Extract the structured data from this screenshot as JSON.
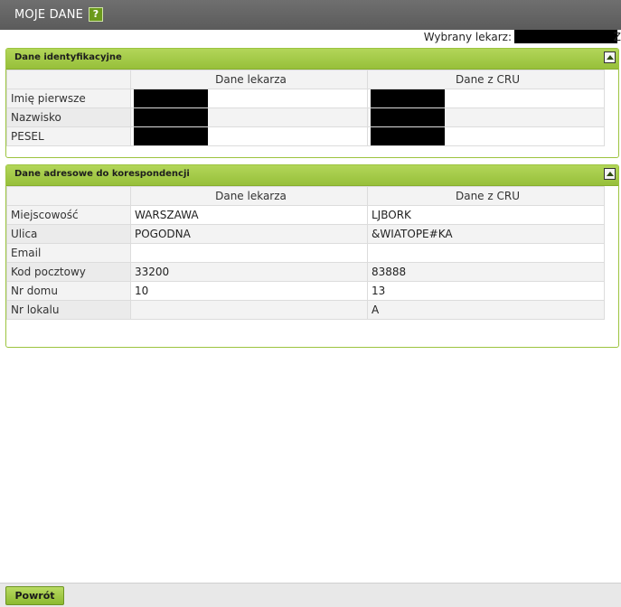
{
  "header": {
    "title": "MOJE DANE",
    "help_icon": "question-icon",
    "help_glyph": "?"
  },
  "doctor": {
    "label": "Wybrany lekarz:",
    "tail": "Z"
  },
  "identification": {
    "title": "Dane identyfikacyjne",
    "columns": [
      "Dane lekarza",
      "Dane z CRU"
    ],
    "rows": [
      {
        "label": "Imię pierwsze"
      },
      {
        "label": "Nazwisko"
      },
      {
        "label": "PESEL"
      }
    ]
  },
  "address": {
    "title": "Dane adresowe do korespondencji",
    "columns": [
      "Dane lekarza",
      "Dane z CRU"
    ],
    "rows": [
      {
        "label": "Miejscowość",
        "doctor": "WARSZAWA",
        "cru": "LJBORK"
      },
      {
        "label": "Ulica",
        "doctor": "POGODNA",
        "cru": "&WIATOPE#KA"
      },
      {
        "label": "Email",
        "doctor": "",
        "cru": ""
      },
      {
        "label": "Kod pocztowy",
        "doctor": "33200",
        "cru": "83888"
      },
      {
        "label": "Nr domu",
        "doctor": "10",
        "cru": "13"
      },
      {
        "label": "Nr lokalu",
        "doctor": "",
        "cru": "A"
      }
    ]
  },
  "footer": {
    "back_label": "Powrót"
  },
  "colors": {
    "accent": "#9cc43f",
    "titlebar": "#636363"
  }
}
